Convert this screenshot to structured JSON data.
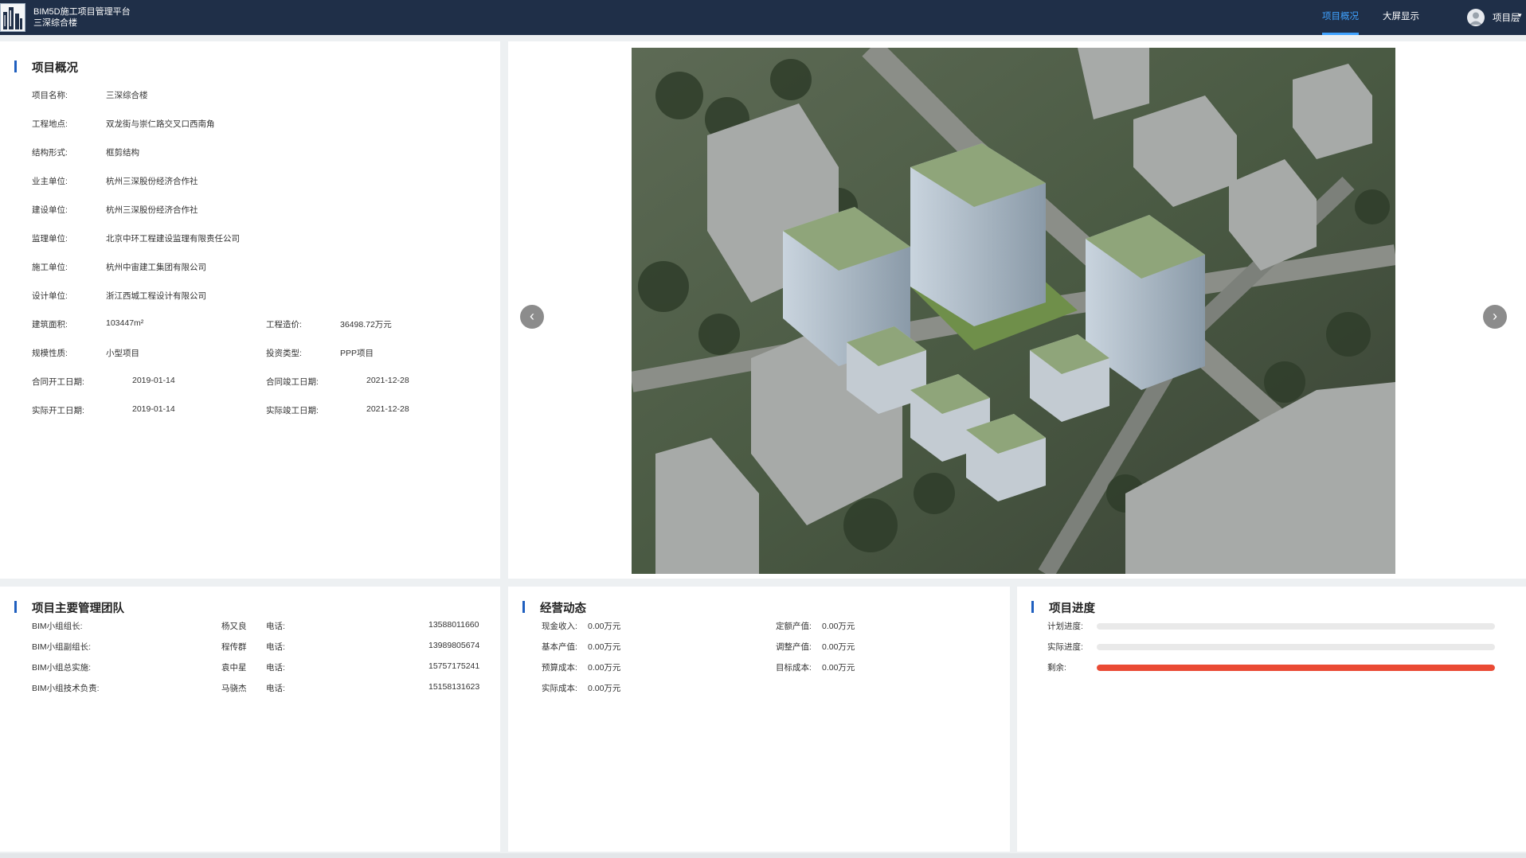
{
  "header": {
    "platform_title": "BIM5D施工项目管理平台",
    "project_name": "三深综合楼",
    "nav": [
      {
        "label": "项目概况",
        "active": true
      },
      {
        "label": "大屏显示",
        "active": false
      }
    ],
    "user": {
      "label": "项目层",
      "caret": "▾"
    }
  },
  "overview": {
    "title": "项目概况",
    "rows": [
      {
        "label": "项目名称:",
        "value": "三深综合楼"
      },
      {
        "label": "工程地点:",
        "value": "双龙街与崇仁路交叉口西南角"
      },
      {
        "label": "结构形式:",
        "value": "框剪结构"
      },
      {
        "label": "业主单位:",
        "value": "杭州三深股份经济合作社"
      },
      {
        "label": "建设单位:",
        "value": "杭州三深股份经济合作社"
      },
      {
        "label": "监理单位:",
        "value": "北京中环工程建设监理有限责任公司"
      },
      {
        "label": "施工单位:",
        "value": "杭州中宙建工集团有限公司"
      },
      {
        "label": "设计单位:",
        "value": "浙江西城工程设计有限公司"
      }
    ],
    "pairs": [
      {
        "l1": "建筑面积:",
        "v1": "103447m²",
        "l2": "工程造价:",
        "v2": "36498.72万元"
      },
      {
        "l1": "规模性质:",
        "v1": "小型项目",
        "l2": "投资类型:",
        "v2": "PPP项目"
      },
      {
        "l1": "合同开工日期:",
        "v1": "2019-01-14",
        "l2": "合同竣工日期:",
        "v2": "2021-12-28"
      },
      {
        "l1": "实际开工日期:",
        "v1": "2019-01-14",
        "l2": "实际竣工日期:",
        "v2": "2021-12-28"
      }
    ]
  },
  "carousel": {
    "prev_icon": "chevron-left-icon",
    "next_icon": "chevron-right-icon",
    "prev_glyph": "‹",
    "next_glyph": "›"
  },
  "team": {
    "title": "项目主要管理团队",
    "members": [
      {
        "role": "BIM小组组长:",
        "name": "杨又良",
        "phone_label": "电话:",
        "phone": "13588011660"
      },
      {
        "role": "BIM小组副组长:",
        "name": "程传群",
        "phone_label": "电话:",
        "phone": "13989805674"
      },
      {
        "role": "BIM小组总实施:",
        "name": "袁中星",
        "phone_label": "电话:",
        "phone": "15757175241"
      },
      {
        "role": "BIM小组技术负责:",
        "name": "马骁杰",
        "phone_label": "电话:",
        "phone": "15158131623"
      }
    ]
  },
  "business": {
    "title": "经营动态",
    "items": [
      {
        "label": "现金收入:",
        "value": "0.00万元"
      },
      {
        "label": "定额产值:",
        "value": "0.00万元"
      },
      {
        "label": "基本产值:",
        "value": "0.00万元"
      },
      {
        "label": "调整产值:",
        "value": "0.00万元"
      },
      {
        "label": "预算成本:",
        "value": "0.00万元"
      },
      {
        "label": "目标成本:",
        "value": "0.00万元"
      },
      {
        "label": "实际成本:",
        "value": "0.00万元"
      }
    ]
  },
  "progress": {
    "title": "项目进度",
    "bars": [
      {
        "label": "计划进度:",
        "fraction": 0,
        "color": "#e9e9e9"
      },
      {
        "label": "实际进度:",
        "fraction": 0,
        "color": "#e9e9e9"
      },
      {
        "label": "剩余:",
        "fraction": 1,
        "color": "#ea4a34"
      }
    ]
  },
  "colors": {
    "header_bg": "#1f2f48",
    "accent": "#3fa2ff",
    "title_bar": "#1f5fbf",
    "remaining_bar": "#ea4a34"
  }
}
